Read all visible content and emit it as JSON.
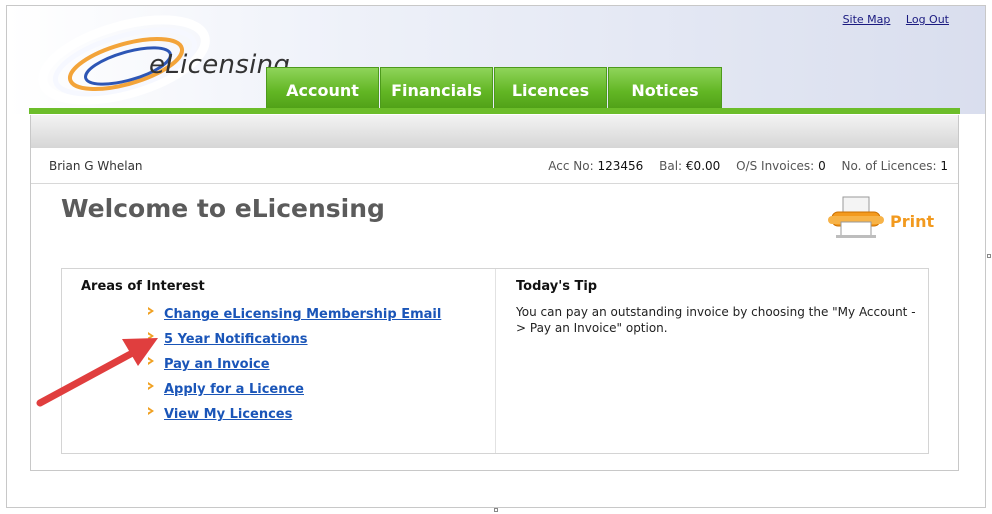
{
  "header": {
    "logo_text": "eLicensing",
    "top_links": {
      "site_map": "Site Map",
      "log_out": "Log Out"
    }
  },
  "nav": {
    "tabs": [
      {
        "label": "Account"
      },
      {
        "label": "Financials"
      },
      {
        "label": "Licences"
      },
      {
        "label": "Notices"
      }
    ]
  },
  "user": {
    "name": "Brian G Whelan",
    "acc_no_label": "Acc No:",
    "acc_no": "123456",
    "bal_label": "Bal:",
    "bal": "€0.00",
    "os_invoices_label": "O/S Invoices:",
    "os_invoices": "0",
    "licences_label": "No. of Licences:",
    "licences": "1"
  },
  "page": {
    "title": "Welcome to eLicensing",
    "print_label": "Print"
  },
  "areas": {
    "title": "Areas of Interest",
    "links": [
      {
        "label": "Change eLicensing Membership Email"
      },
      {
        "label": "5 Year Notifications"
      },
      {
        "label": "Pay an Invoice"
      },
      {
        "label": "Apply for a Licence"
      },
      {
        "label": "View My Licences"
      }
    ]
  },
  "tip": {
    "title": "Today's Tip",
    "text": "You can pay an outstanding invoice by choosing the \"My Account -> Pay an Invoice\" option."
  },
  "colors": {
    "nav_green": "#62b624",
    "link_blue": "#1a55b8",
    "print_orange": "#f29a1f",
    "arrow_red": "#e03e3e"
  }
}
